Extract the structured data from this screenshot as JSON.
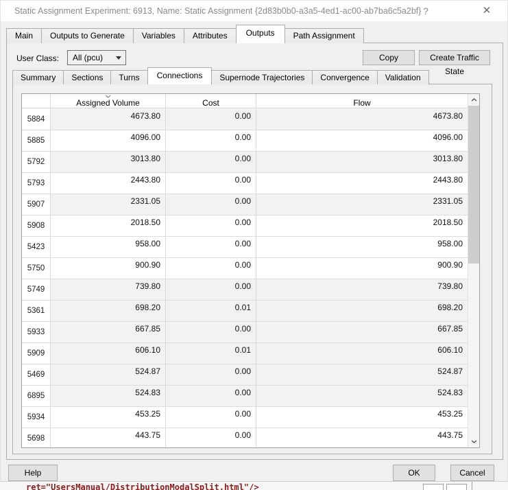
{
  "window": {
    "title": "Static Assignment Experiment: 6913, Name: Static Assignment  {2d83b0b0-a3a5-4ed1-ac00-ab7ba6c5a2bf}",
    "help_glyph": "?",
    "close_glyph": "✕"
  },
  "tabs": {
    "items": [
      "Main",
      "Outputs to Generate",
      "Variables",
      "Attributes",
      "Outputs",
      "Path Assignment"
    ],
    "active": "Outputs"
  },
  "toolbar": {
    "user_class_label": "User Class:",
    "user_class_value": "All (pcu)",
    "copy_label": "Copy",
    "create_traffic_state_label": "Create Traffic State"
  },
  "subtabs": {
    "items": [
      "Summary",
      "Sections",
      "Turns",
      "Connections",
      "Supernode Trajectories",
      "Convergence",
      "Validation"
    ],
    "active": "Connections"
  },
  "table": {
    "columns": [
      "Assigned Volume",
      "Cost",
      "Flow"
    ],
    "sorted_column": "Assigned Volume",
    "sort_direction": "descending",
    "rows": [
      {
        "id": "5884",
        "volume": "4673.80",
        "cost": "0.00",
        "flow": "4673.80",
        "shaded": true
      },
      {
        "id": "5885",
        "volume": "4096.00",
        "cost": "0.00",
        "flow": "4096.00",
        "shaded": false
      },
      {
        "id": "5792",
        "volume": "3013.80",
        "cost": "0.00",
        "flow": "3013.80",
        "shaded": true
      },
      {
        "id": "5793",
        "volume": "2443.80",
        "cost": "0.00",
        "flow": "2443.80",
        "shaded": false
      },
      {
        "id": "5907",
        "volume": "2331.05",
        "cost": "0.00",
        "flow": "2331.05",
        "shaded": true
      },
      {
        "id": "5908",
        "volume": "2018.50",
        "cost": "0.00",
        "flow": "2018.50",
        "shaded": false
      },
      {
        "id": "5423",
        "volume": "958.00",
        "cost": "0.00",
        "flow": "958.00",
        "shaded": false
      },
      {
        "id": "5750",
        "volume": "900.90",
        "cost": "0.00",
        "flow": "900.90",
        "shaded": false
      },
      {
        "id": "5749",
        "volume": "739.80",
        "cost": "0.00",
        "flow": "739.80",
        "shaded": true
      },
      {
        "id": "5361",
        "volume": "698.20",
        "cost": "0.01",
        "flow": "698.20",
        "shaded": true
      },
      {
        "id": "5933",
        "volume": "667.85",
        "cost": "0.00",
        "flow": "667.85",
        "shaded": true
      },
      {
        "id": "5909",
        "volume": "606.10",
        "cost": "0.01",
        "flow": "606.10",
        "shaded": true
      },
      {
        "id": "5469",
        "volume": "524.87",
        "cost": "0.00",
        "flow": "524.87",
        "shaded": true
      },
      {
        "id": "6895",
        "volume": "524.83",
        "cost": "0.00",
        "flow": "524.83",
        "shaded": true
      },
      {
        "id": "5934",
        "volume": "453.25",
        "cost": "0.00",
        "flow": "453.25",
        "shaded": false
      },
      {
        "id": "5698",
        "volume": "443.75",
        "cost": "0.00",
        "flow": "443.75",
        "shaded": false
      }
    ]
  },
  "footer": {
    "help_label": "Help",
    "ok_label": "OK",
    "cancel_label": "Cancel"
  },
  "background_window": {
    "code_text": "ret=\"UsersManual/DistributionModalSplit.html\"/>"
  },
  "colors": {
    "dialog_bg": "#f0f0f0",
    "alt_row": "#f2f2f2",
    "grid_line": "#d9d9d9",
    "code_text": "#8b1a1a",
    "title_text": "#8a8a8a"
  }
}
